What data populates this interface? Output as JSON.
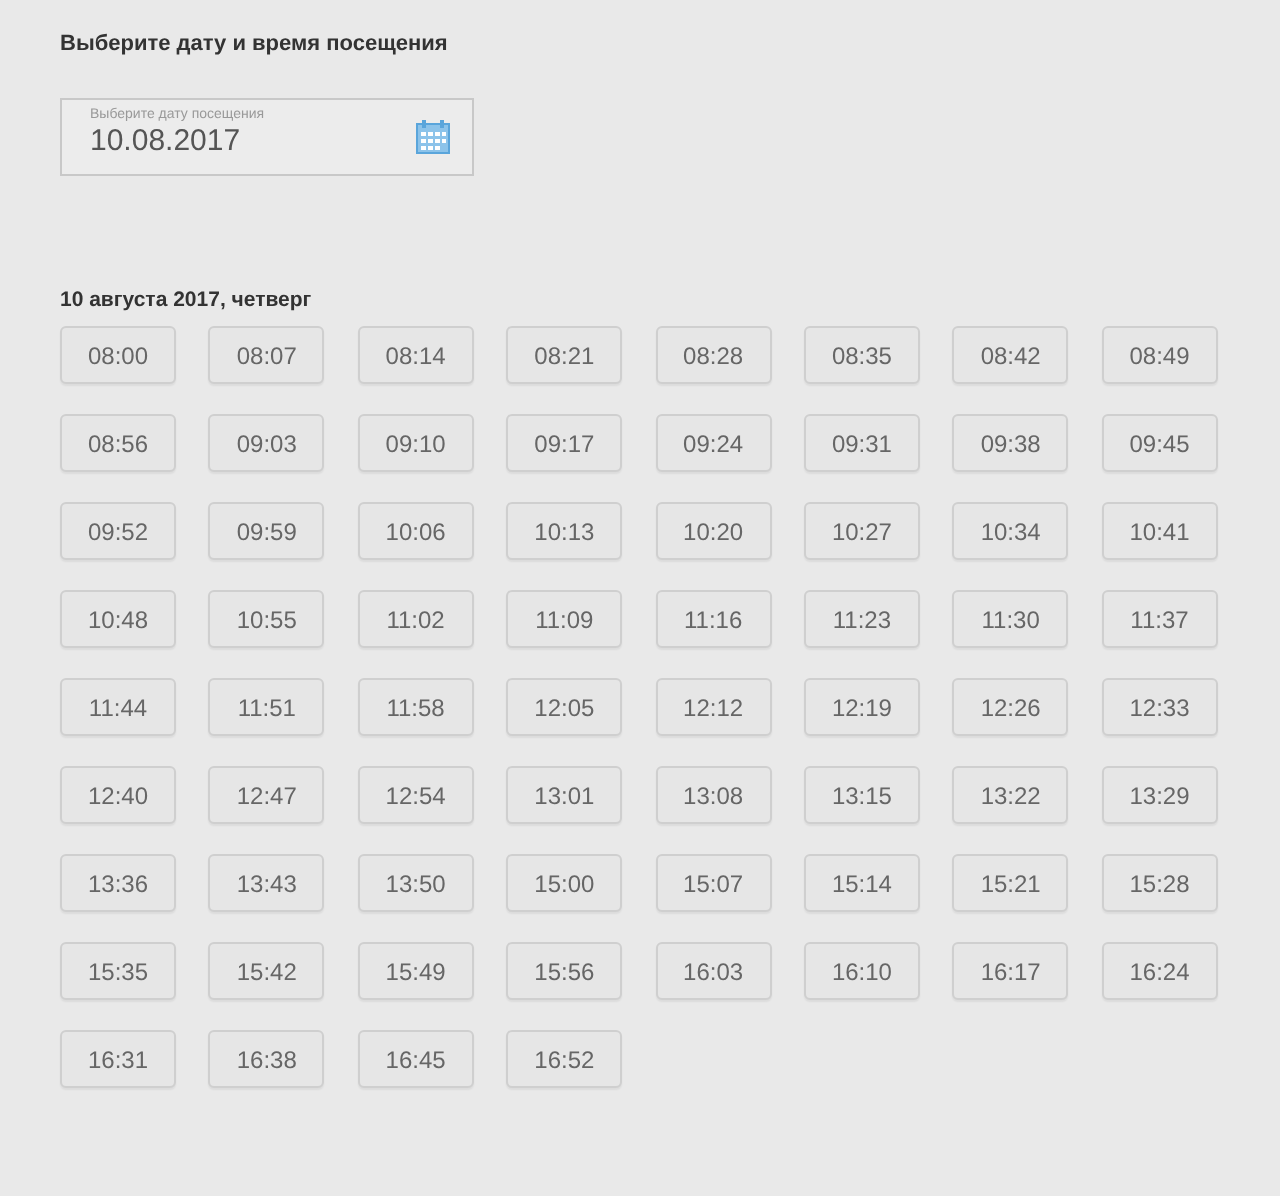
{
  "title": "Выберите дату и время посещения",
  "date_field": {
    "label": "Выберите дату посещения",
    "value": "10.08.2017"
  },
  "day_heading": "10 августа 2017, четверг",
  "times": [
    "08:00",
    "08:07",
    "08:14",
    "08:21",
    "08:28",
    "08:35",
    "08:42",
    "08:49",
    "08:56",
    "09:03",
    "09:10",
    "09:17",
    "09:24",
    "09:31",
    "09:38",
    "09:45",
    "09:52",
    "09:59",
    "10:06",
    "10:13",
    "10:20",
    "10:27",
    "10:34",
    "10:41",
    "10:48",
    "10:55",
    "11:02",
    "11:09",
    "11:16",
    "11:23",
    "11:30",
    "11:37",
    "11:44",
    "11:51",
    "11:58",
    "12:05",
    "12:12",
    "12:19",
    "12:26",
    "12:33",
    "12:40",
    "12:47",
    "12:54",
    "13:01",
    "13:08",
    "13:15",
    "13:22",
    "13:29",
    "13:36",
    "13:43",
    "13:50",
    "15:00",
    "15:07",
    "15:14",
    "15:21",
    "15:28",
    "15:35",
    "15:42",
    "15:49",
    "15:56",
    "16:03",
    "16:10",
    "16:17",
    "16:24",
    "16:31",
    "16:38",
    "16:45",
    "16:52"
  ]
}
